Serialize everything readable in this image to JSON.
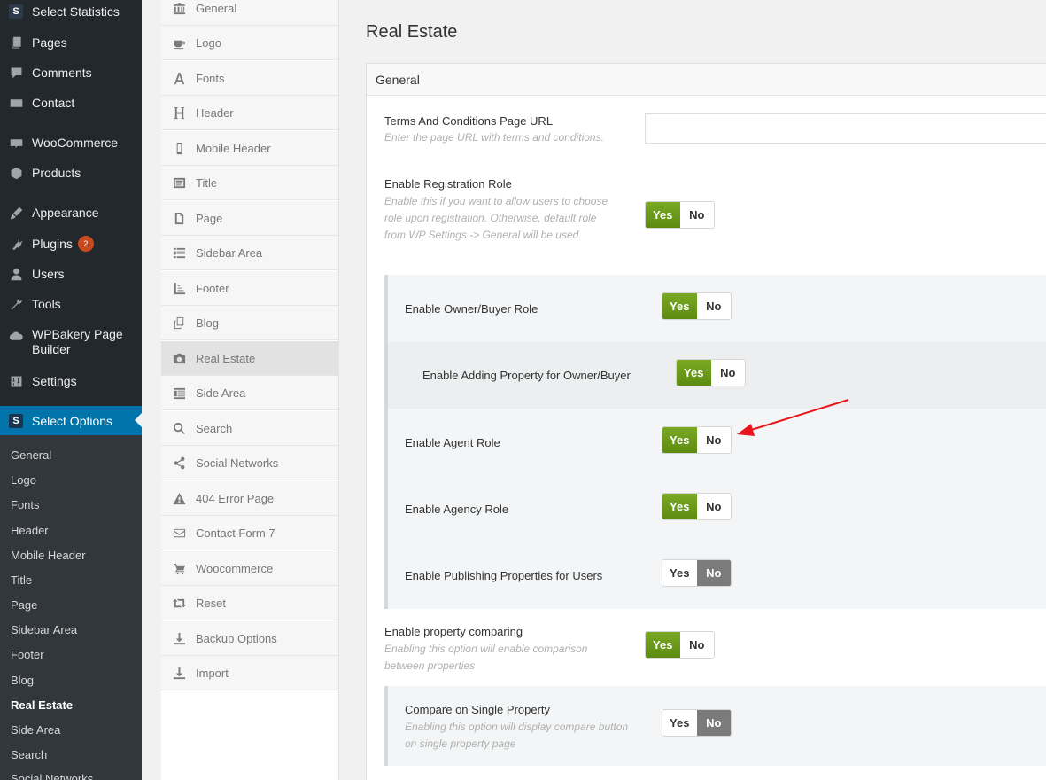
{
  "wp_menu": {
    "items": [
      {
        "label": "Select Statistics",
        "icon": "select-s-logo"
      },
      {
        "label": "Pages",
        "icon": "pages-icon"
      },
      {
        "label": "Comments",
        "icon": "comments-icon"
      },
      {
        "label": "Contact",
        "icon": "mail-icon"
      },
      {
        "label": "WooCommerce",
        "icon": "woocommerce-icon"
      },
      {
        "label": "Products",
        "icon": "box-icon"
      },
      {
        "label": "Appearance",
        "icon": "brush-icon"
      },
      {
        "label": "Plugins",
        "icon": "plug-icon",
        "badge": "2"
      },
      {
        "label": "Users",
        "icon": "user-icon"
      },
      {
        "label": "Tools",
        "icon": "wrench-icon"
      },
      {
        "label": "WPBakery Page Builder",
        "icon": "cloud-icon"
      },
      {
        "label": "Settings",
        "icon": "sliders-icon"
      },
      {
        "label": "Select Options",
        "icon": "select-s-logo"
      }
    ],
    "logo_letter": "S",
    "submenu": [
      "General",
      "Logo",
      "Fonts",
      "Header",
      "Mobile Header",
      "Title",
      "Page",
      "Sidebar Area",
      "Footer",
      "Blog",
      "Real Estate",
      "Side Area",
      "Search",
      "Social Networks"
    ],
    "colors": {
      "bg": "#23282d",
      "active": "#0073aa",
      "badge": "#ca4a1f"
    }
  },
  "options_nav": {
    "items": [
      {
        "label": "General",
        "icon": "bank-icon"
      },
      {
        "label": "Logo",
        "icon": "coffee-icon"
      },
      {
        "label": "Fonts",
        "icon": "font-icon"
      },
      {
        "label": "Header",
        "icon": "header-icon"
      },
      {
        "label": "Mobile Header",
        "icon": "mobile-icon"
      },
      {
        "label": "Title",
        "icon": "title-icon"
      },
      {
        "label": "Page",
        "icon": "page-icon"
      },
      {
        "label": "Sidebar Area",
        "icon": "sidebar-icon"
      },
      {
        "label": "Footer",
        "icon": "footer-icon"
      },
      {
        "label": "Blog",
        "icon": "copy-icon"
      },
      {
        "label": "Real Estate",
        "icon": "camera-icon"
      },
      {
        "label": "Side Area",
        "icon": "side-area-icon"
      },
      {
        "label": "Search",
        "icon": "search-icon"
      },
      {
        "label": "Social Networks",
        "icon": "share-icon"
      },
      {
        "label": "404 Error Page",
        "icon": "warning-icon"
      },
      {
        "label": "Contact Form 7",
        "icon": "envelope-icon"
      },
      {
        "label": "Woocommerce",
        "icon": "cart-icon"
      },
      {
        "label": "Reset",
        "icon": "retweet-icon"
      },
      {
        "label": "Backup Options",
        "icon": "download-icon"
      },
      {
        "label": "Import",
        "icon": "import-icon"
      }
    ]
  },
  "main": {
    "title": "Real Estate",
    "panel_title": "General",
    "terms": {
      "label": "Terms And Conditions Page URL",
      "desc": "Enter the page URL with terms and conditions.",
      "value": ""
    },
    "registration_role": {
      "label": "Enable Registration Role",
      "desc": "Enable this if you want to allow users to choose role upon registration. Otherwise, default role from WP Settings -> General will be used.",
      "value": "Yes"
    },
    "owner_buyer": {
      "label": "Enable Owner/Buyer Role",
      "value": "Yes"
    },
    "adding_property": {
      "label": "Enable Adding Property for Owner/Buyer",
      "value": "Yes"
    },
    "agent_role": {
      "label": "Enable Agent Role",
      "value": "Yes"
    },
    "agency_role": {
      "label": "Enable Agency Role",
      "value": "Yes"
    },
    "publishing": {
      "label": "Enable Publishing Properties for Users",
      "value": "No"
    },
    "comparing": {
      "label": "Enable property comparing",
      "desc": "Enabling this option will enable comparison between properties",
      "value": "Yes"
    },
    "compare_single": {
      "label": "Compare on Single Property",
      "desc": "Enabling this option will display compare button on single property page",
      "value": "No"
    },
    "switch_labels": {
      "yes": "Yes",
      "no": "No"
    },
    "colors": {
      "yes_active": "#6a9a17",
      "no_active": "#7b7b7b",
      "annotation_arrow": "#e8161b"
    }
  }
}
